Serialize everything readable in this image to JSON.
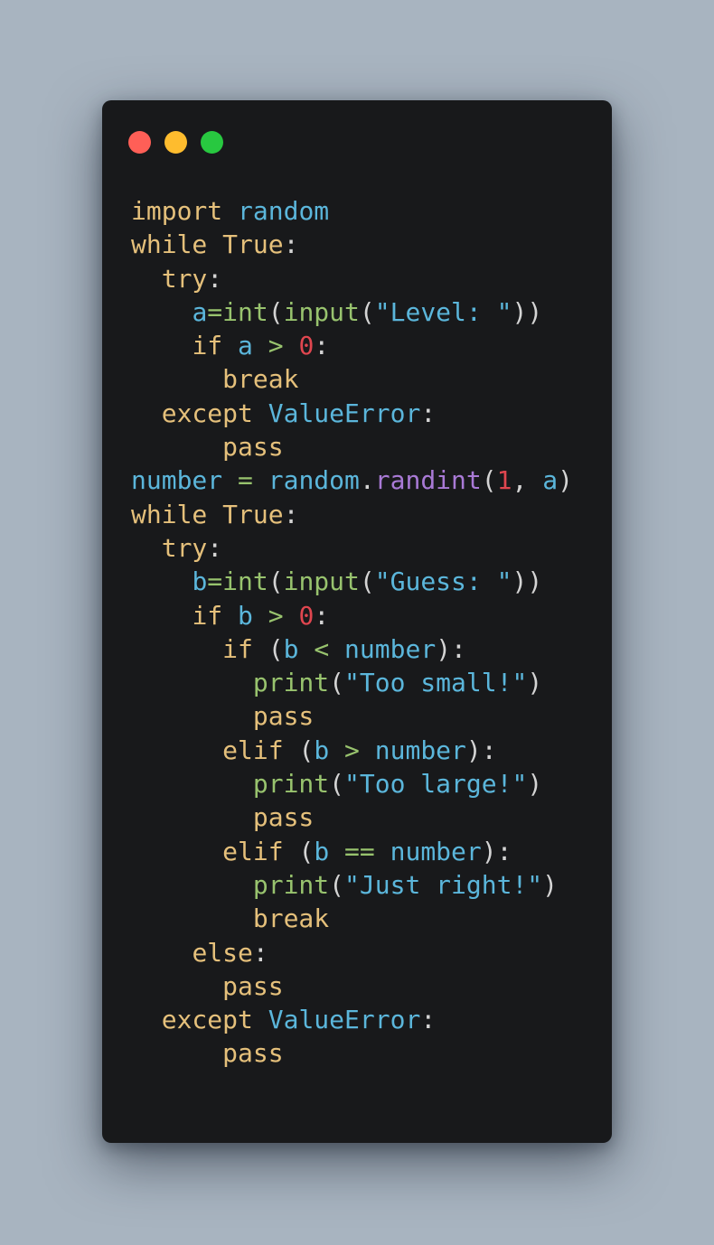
{
  "colors": {
    "background": "#a8b4c0",
    "window": "#18191b",
    "dot_close": "#ff5f57",
    "dot_minimize": "#febc2e",
    "dot_zoom": "#28c840"
  },
  "window_controls": [
    {
      "name": "close",
      "icon": "close-dot-icon",
      "color": "#ff5f57"
    },
    {
      "name": "minimize",
      "icon": "minimize-dot-icon",
      "color": "#febc2e"
    },
    {
      "name": "zoom",
      "icon": "zoom-dot-icon",
      "color": "#28c840"
    }
  ],
  "syntax_colors": {
    "k": "#e5c07b",
    "f": "#98c36e",
    "v": "#5bb6db",
    "n": "#e0464f",
    "m": "#a97ad6",
    "p": "#d4d4d4"
  },
  "code": [
    [
      [
        "import ",
        "k"
      ],
      [
        "random",
        "v"
      ]
    ],
    [
      [
        "while ",
        "k"
      ],
      [
        "True",
        "k"
      ],
      [
        ":",
        "p"
      ]
    ],
    [
      [
        "  ",
        "p"
      ],
      [
        "try",
        "k"
      ],
      [
        ":",
        "p"
      ]
    ],
    [
      [
        "    ",
        "p"
      ],
      [
        "a",
        "v"
      ],
      [
        "=",
        "f"
      ],
      [
        "int",
        "f"
      ],
      [
        "(",
        "p"
      ],
      [
        "input",
        "f"
      ],
      [
        "(",
        "p"
      ],
      [
        "\"Level: \"",
        "v"
      ],
      [
        "))",
        "p"
      ]
    ],
    [
      [
        "    ",
        "p"
      ],
      [
        "if ",
        "k"
      ],
      [
        "a ",
        "v"
      ],
      [
        "> ",
        "f"
      ],
      [
        "0",
        "n"
      ],
      [
        ":",
        "p"
      ]
    ],
    [
      [
        "      ",
        "p"
      ],
      [
        "break",
        "k"
      ]
    ],
    [
      [
        "  ",
        "p"
      ],
      [
        "except ",
        "k"
      ],
      [
        "ValueError",
        "v"
      ],
      [
        ":",
        "p"
      ]
    ],
    [
      [
        "      ",
        "p"
      ],
      [
        "pass",
        "k"
      ]
    ],
    [
      [
        "number ",
        "v"
      ],
      [
        "= ",
        "f"
      ],
      [
        "random",
        "v"
      ],
      [
        ".",
        "p"
      ],
      [
        "randint",
        "m"
      ],
      [
        "(",
        "p"
      ],
      [
        "1",
        "n"
      ],
      [
        ", ",
        "p"
      ],
      [
        "a",
        "v"
      ],
      [
        ")",
        "p"
      ]
    ],
    [
      [
        "while ",
        "k"
      ],
      [
        "True",
        "k"
      ],
      [
        ":",
        "p"
      ]
    ],
    [
      [
        "  ",
        "p"
      ],
      [
        "try",
        "k"
      ],
      [
        ":",
        "p"
      ]
    ],
    [
      [
        "    ",
        "p"
      ],
      [
        "b",
        "v"
      ],
      [
        "=",
        "f"
      ],
      [
        "int",
        "f"
      ],
      [
        "(",
        "p"
      ],
      [
        "input",
        "f"
      ],
      [
        "(",
        "p"
      ],
      [
        "\"Guess: \"",
        "v"
      ],
      [
        "))",
        "p"
      ]
    ],
    [
      [
        "    ",
        "p"
      ],
      [
        "if ",
        "k"
      ],
      [
        "b ",
        "v"
      ],
      [
        "> ",
        "f"
      ],
      [
        "0",
        "n"
      ],
      [
        ":",
        "p"
      ]
    ],
    [
      [
        "      ",
        "p"
      ],
      [
        "if ",
        "k"
      ],
      [
        "(",
        "p"
      ],
      [
        "b ",
        "v"
      ],
      [
        "< ",
        "f"
      ],
      [
        "number",
        "v"
      ],
      [
        "):",
        "p"
      ]
    ],
    [
      [
        "        ",
        "p"
      ],
      [
        "print",
        "f"
      ],
      [
        "(",
        "p"
      ],
      [
        "\"Too small!\"",
        "v"
      ],
      [
        ")",
        "p"
      ]
    ],
    [
      [
        "        ",
        "p"
      ],
      [
        "pass",
        "k"
      ]
    ],
    [
      [
        "      ",
        "p"
      ],
      [
        "elif ",
        "k"
      ],
      [
        "(",
        "p"
      ],
      [
        "b ",
        "v"
      ],
      [
        "> ",
        "f"
      ],
      [
        "number",
        "v"
      ],
      [
        "):",
        "p"
      ]
    ],
    [
      [
        "        ",
        "p"
      ],
      [
        "print",
        "f"
      ],
      [
        "(",
        "p"
      ],
      [
        "\"Too large!\"",
        "v"
      ],
      [
        ")",
        "p"
      ]
    ],
    [
      [
        "        ",
        "p"
      ],
      [
        "pass",
        "k"
      ]
    ],
    [
      [
        "      ",
        "p"
      ],
      [
        "elif ",
        "k"
      ],
      [
        "(",
        "p"
      ],
      [
        "b ",
        "v"
      ],
      [
        "== ",
        "f"
      ],
      [
        "number",
        "v"
      ],
      [
        "):",
        "p"
      ]
    ],
    [
      [
        "        ",
        "p"
      ],
      [
        "print",
        "f"
      ],
      [
        "(",
        "p"
      ],
      [
        "\"Just right!\"",
        "v"
      ],
      [
        ")",
        "p"
      ]
    ],
    [
      [
        "        ",
        "p"
      ],
      [
        "break",
        "k"
      ]
    ],
    [
      [
        "    ",
        "p"
      ],
      [
        "else",
        "k"
      ],
      [
        ":",
        "p"
      ]
    ],
    [
      [
        "      ",
        "p"
      ],
      [
        "pass",
        "k"
      ]
    ],
    [
      [
        "  ",
        "p"
      ],
      [
        "except ",
        "k"
      ],
      [
        "ValueError",
        "v"
      ],
      [
        ":",
        "p"
      ]
    ],
    [
      [
        "      ",
        "p"
      ],
      [
        "pass",
        "k"
      ]
    ]
  ]
}
